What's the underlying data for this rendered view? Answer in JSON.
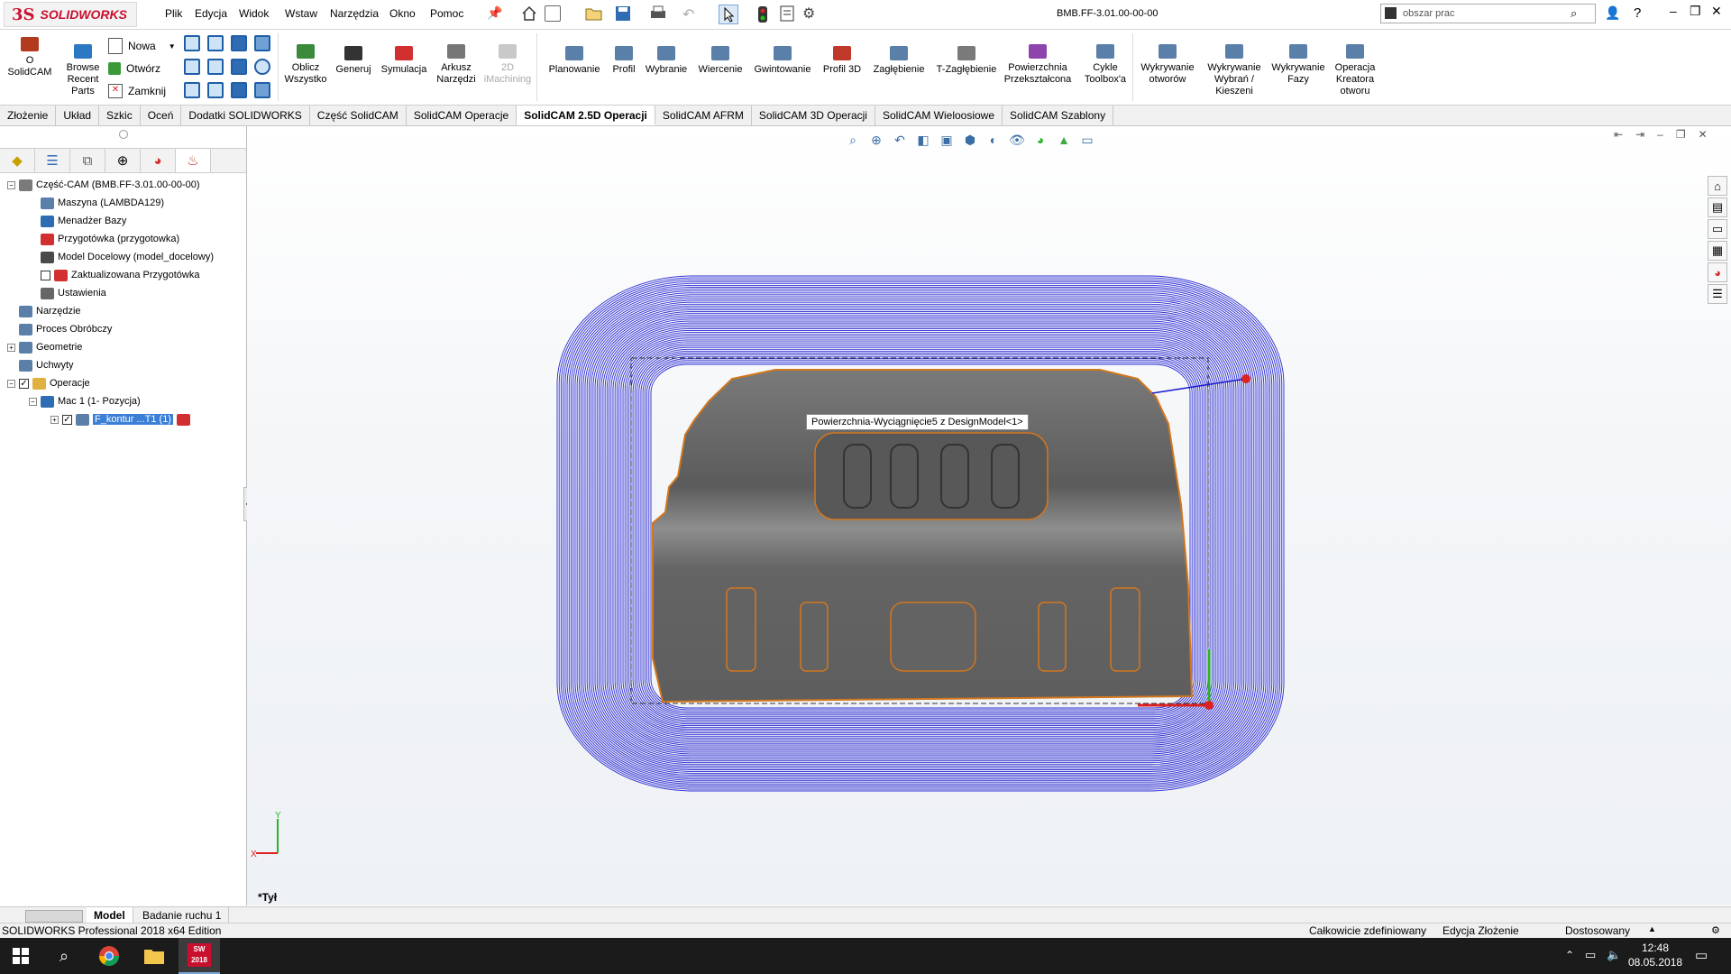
{
  "app": {
    "logo_ds": "3S",
    "logo_name": "SOLIDWORKS",
    "menu": [
      "Plik",
      "Edycja",
      "Widok",
      "Wstaw",
      "Narzędzia",
      "Okno",
      "Pomoc"
    ],
    "document_title": "BMB.FF-3.01.00-00-00",
    "search_placeholder": "obszar prac",
    "help": "?"
  },
  "ribbon": {
    "buttons_left": [
      {
        "label": "O\nSolidCAM",
        "icon": "solidcam-icon",
        "color": "#b23a1f"
      },
      {
        "label": "Browse\nRecent\nParts",
        "icon": "browse-recent-parts-icon",
        "color": "#2b79c2"
      }
    ],
    "file_actions": [
      "Nowa",
      "Otwórz",
      "Zamknij"
    ],
    "buttons": [
      {
        "label": "Oblicz\nWszystko",
        "icon": "calculate-all-icon",
        "color": "#3a8a3a",
        "disabled": false
      },
      {
        "label": "Generuj",
        "icon": "generate-gcode-icon",
        "color": "#333333",
        "disabled": false
      },
      {
        "label": "Symulacja",
        "icon": "simulation-icon",
        "color": "#d23030",
        "disabled": false
      },
      {
        "label": "Arkusz\nNarzędzi",
        "icon": "tool-sheet-icon",
        "color": "#777777",
        "disabled": false
      },
      {
        "label": "2D\niMachining",
        "icon": "imachining-2d-icon",
        "color": "#c9c9c9",
        "disabled": true
      },
      {
        "label": "Planowanie",
        "icon": "facing-icon",
        "color": "#5a7fa8",
        "disabled": false
      },
      {
        "label": "Profil",
        "icon": "profile-icon",
        "color": "#5a7fa8",
        "disabled": false
      },
      {
        "label": "Wybranie",
        "icon": "pocket-icon",
        "color": "#5a7fa8",
        "disabled": false
      },
      {
        "label": "Wiercenie",
        "icon": "drilling-icon",
        "color": "#5a7fa8",
        "disabled": false
      },
      {
        "label": "Gwintowanie",
        "icon": "threading-icon",
        "color": "#5a7fa8",
        "disabled": false
      },
      {
        "label": "Profil 3D",
        "icon": "profile-3d-icon",
        "color": "#c0392b",
        "disabled": false
      },
      {
        "label": "Zagłębienie",
        "icon": "slot-icon",
        "color": "#5a7fa8",
        "disabled": false
      },
      {
        "label": "T-Zagłębienie",
        "icon": "t-slot-icon",
        "color": "#7a7a7a",
        "disabled": false
      },
      {
        "label": "Powierzchnia\nPrzekształcona",
        "icon": "transformed-surface-icon",
        "color": "#8e44ad",
        "disabled": false
      },
      {
        "label": "Cykle\nToolbox'a",
        "icon": "toolbox-cycles-icon",
        "color": "#5a7fa8",
        "disabled": false
      },
      {
        "label": "Wykrywanie\notworów",
        "icon": "hole-recognition-icon",
        "color": "#5a7fa8",
        "disabled": false
      },
      {
        "label": "Wykrywanie\nWybrań /\nKieszeni",
        "icon": "pocket-recognition-icon",
        "color": "#5a7fa8",
        "disabled": false
      },
      {
        "label": "Wykrywanie\nFazy",
        "icon": "chamfer-recognition-icon",
        "color": "#5a7fa8",
        "disabled": false
      },
      {
        "label": "Operacja\nKreatora\notworu",
        "icon": "hole-wizard-icon",
        "color": "#5a7fa8",
        "disabled": false
      }
    ]
  },
  "tabs": [
    {
      "label": "Złożenie",
      "active": false
    },
    {
      "label": "Układ",
      "active": false
    },
    {
      "label": "Szkic",
      "active": false
    },
    {
      "label": "Oceń",
      "active": false
    },
    {
      "label": "Dodatki SOLIDWORKS",
      "active": false
    },
    {
      "label": "Część SolidCAM",
      "active": false
    },
    {
      "label": "SolidCAM Operacje",
      "active": false
    },
    {
      "label": "SolidCAM 2.5D Operacji",
      "active": true
    },
    {
      "label": "SolidCAM AFRM",
      "active": false
    },
    {
      "label": "SolidCAM 3D Operacji",
      "active": false
    },
    {
      "label": "SolidCAM Wieloosiowe",
      "active": false
    },
    {
      "label": "SolidCAM Szablony",
      "active": false
    }
  ],
  "tree": [
    {
      "label": "Część-CAM (BMB.FF-3.01.00-00-00)",
      "level": 0,
      "expander": "-",
      "icon": "cam-part-icon",
      "color": "#7a7a7a"
    },
    {
      "label": "Maszyna (LAMBDA129)",
      "level": 1,
      "icon": "machine-icon",
      "color": "#5a7fa8"
    },
    {
      "label": "Menadżer Bazy",
      "level": 1,
      "icon": "coordinate-system-icon",
      "color": "#2e6db4"
    },
    {
      "label": "Przygotówka (przygotowka)",
      "level": 1,
      "icon": "stock-icon",
      "color": "#d23030"
    },
    {
      "label": "Model Docelowy (model_docelowy)",
      "level": 1,
      "icon": "target-model-icon",
      "color": "#4a4a4a"
    },
    {
      "label": "Zaktualizowana Przygotówka",
      "level": 1,
      "checkbox": true,
      "icon": "updated-stock-icon",
      "color": "#d23030"
    },
    {
      "label": "Ustawienia",
      "level": 1,
      "icon": "settings-wrench-icon",
      "color": "#666666"
    },
    {
      "label": "Narzędzie",
      "level": 0,
      "icon": "tool-icon",
      "color": "#5a7fa8"
    },
    {
      "label": "Proces Obróbczy",
      "level": 0,
      "icon": "machining-process-icon",
      "color": "#5a7fa8"
    },
    {
      "label": "Geometrie",
      "level": 0,
      "expander": "+",
      "icon": "geometry-icon",
      "color": "#5a7fa8"
    },
    {
      "label": "Uchwyty",
      "level": 0,
      "icon": "fixtures-icon",
      "color": "#5a7fa8"
    },
    {
      "label": "Operacje",
      "level": 0,
      "expander": "-",
      "checkbox": true,
      "checked": true,
      "icon": "operations-folder-icon",
      "color": "#e0b040"
    },
    {
      "label": "Mac 1 (1- Pozycja)",
      "level": 1,
      "expander": "-",
      "icon": "coordinate-system-icon",
      "color": "#2e6db4"
    },
    {
      "label": "F_kontur ...T1 (1)",
      "level": 2,
      "expander": "+",
      "checkbox": true,
      "checked": true,
      "selected": true,
      "icon": "profile-operation-icon",
      "color": "#5a7fa8"
    }
  ],
  "viewport": {
    "tooltip": "Powierzchnia-Wyciągnięcie5 z DesignModel<1>",
    "view_label": "*Tył",
    "triad": {
      "x": "X",
      "y": "Y"
    },
    "toolpath_color": "#2b2bd4",
    "part_color": "#6a6a6a",
    "contour_color": "#d2771e"
  },
  "bottom_tabs": [
    "Model",
    "Badanie ruchu 1"
  ],
  "status": {
    "left": "SOLIDWORKS Professional 2018 x64 Edition",
    "definition": "Całkowicie zdefiniowany",
    "mode": "Edycja Złożenie",
    "units": "Dostosowany"
  },
  "taskbar": {
    "time": "12:48",
    "date": "08.05.2018",
    "sw_label": "SW\n2018"
  }
}
